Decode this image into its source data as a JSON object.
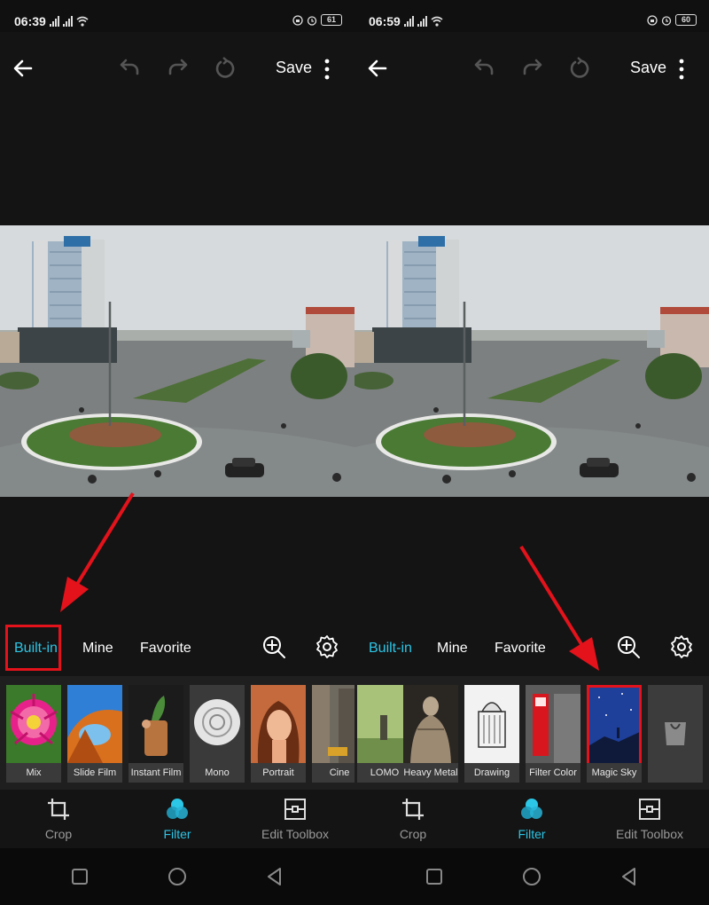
{
  "panels": [
    {
      "status": {
        "time": "06:39",
        "battery": "61"
      },
      "toolbar": {
        "save_label": "Save"
      },
      "filter_tabs": [
        {
          "label": "Built-in",
          "active": true
        },
        {
          "label": "Mine",
          "active": false
        },
        {
          "label": "Favorite",
          "active": false
        }
      ],
      "thumbnails": [
        "Mix",
        "Slide Film",
        "Instant Film",
        "Mono",
        "Portrait",
        "Cine"
      ],
      "bottom_nav": [
        {
          "label": "Crop",
          "active": false
        },
        {
          "label": "Filter",
          "active": true
        },
        {
          "label": "Edit Toolbox",
          "active": false
        }
      ]
    },
    {
      "status": {
        "time": "06:59",
        "battery": "60"
      },
      "toolbar": {
        "save_label": "Save"
      },
      "filter_tabs": [
        {
          "label": "Built-in",
          "active": true
        },
        {
          "label": "Mine",
          "active": false
        },
        {
          "label": "Favorite",
          "active": false
        }
      ],
      "thumbnails": [
        "LOMO",
        "Heavy Metal",
        "Drawing",
        "Filter Color",
        "Magic Sky"
      ],
      "bottom_nav": [
        {
          "label": "Crop",
          "active": false
        },
        {
          "label": "Filter",
          "active": true
        },
        {
          "label": "Edit Toolbox",
          "active": false
        }
      ]
    }
  ],
  "icons": {
    "toolbar": [
      "back-arrow-icon",
      "undo-icon",
      "redo-icon",
      "reset-icon",
      "more-vertical-icon"
    ],
    "filter_bar": [
      "zoom-in-icon",
      "gear-icon"
    ],
    "bottom_nav": [
      "crop-icon",
      "filter-icon",
      "edit-toolbox-icon"
    ],
    "system_nav": [
      "square-recents-icon",
      "circle-home-icon",
      "triangle-back-icon"
    ],
    "store": "shopping-bag-icon"
  },
  "colors": {
    "accent": "#2cc6e6",
    "highlight": "#e3121b",
    "background": "#141414",
    "thumbnail_strip": "#1f1f1f"
  }
}
